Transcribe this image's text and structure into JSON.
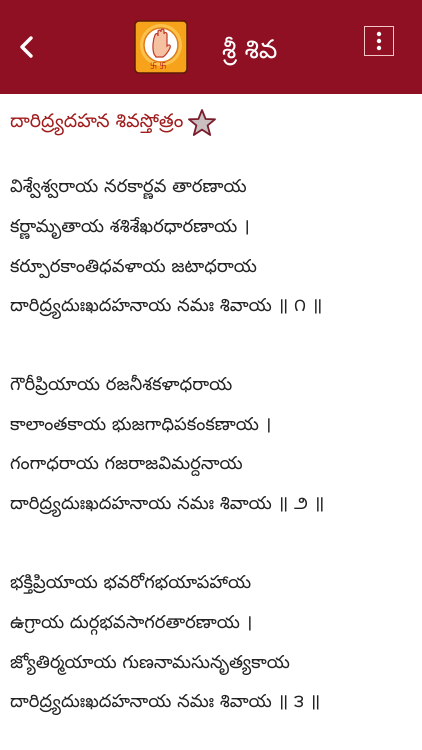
{
  "app_bar": {
    "title": "శ్రీ శివ",
    "back_icon": "chevron-left-icon",
    "menu_icon": "vertical-dots-icon",
    "color": "#8f1022"
  },
  "stotram": {
    "title": "దారిద్ర్యదహన శివస్తోత్రం",
    "favorite_icon": "star-outline-icon",
    "verses": [
      {
        "lines": [
          "విశ్వేశ్వరాయ నరకార్ణవ తారణాయ",
          "కర్ణామృతాయ శశిశేఖరధారణాయ ।",
          "కర్పూరకాంతిధవళాయ జటాధరాయ",
          "దారిద్ర్యదుఃఖదహనాయ నమః శివాయ ॥ ౧ ॥"
        ]
      },
      {
        "lines": [
          "గౌరీప్రియాయ రజనీశకళాధరాయ",
          "కాలాంతకాయ భుజగాధిపకంకణాయ ।",
          "గంగాధరాయ గజరాజవిమర్దనాయ",
          "దారిద్ర్యదుఃఖదహనాయ నమః శివాయ ॥ ౨ ॥"
        ]
      },
      {
        "lines": [
          "భక్తిప్రియాయ భవరోగభయాపహాయ",
          "ఉగ్రాయ దుర్గభవసాగరతారణాయ ।",
          "జ్యోతిర్మయాయ గుణనామసునృత్యకాయ",
          "దారిద్ర్యదుఃఖదహనాయ నమః శివాయ ॥ ౩ ॥"
        ]
      }
    ]
  }
}
